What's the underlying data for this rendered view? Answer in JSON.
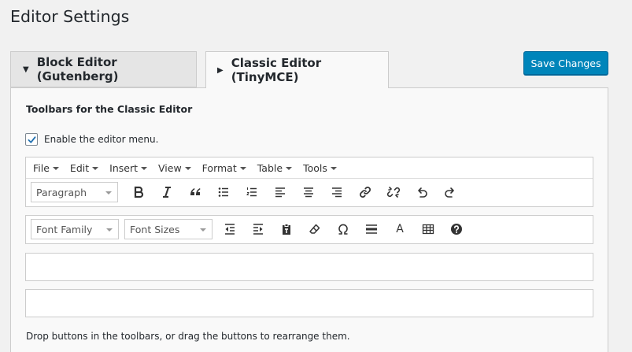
{
  "page": {
    "title": "Editor Settings"
  },
  "tabs": [
    {
      "label": "Block Editor (Gutenberg)",
      "arrow": "▼",
      "active": false
    },
    {
      "label": "Classic Editor (TinyMCE)",
      "arrow": "▶",
      "active": true
    }
  ],
  "save_button": {
    "label": "Save Changes"
  },
  "section": {
    "title": "Toolbars for the Classic Editor"
  },
  "enable_menu": {
    "label": "Enable the editor menu.",
    "checked": true
  },
  "menubar": {
    "items": [
      {
        "label": "File"
      },
      {
        "label": "Edit"
      },
      {
        "label": "Insert"
      },
      {
        "label": "View"
      },
      {
        "label": "Format"
      },
      {
        "label": "Table"
      },
      {
        "label": "Tools"
      }
    ]
  },
  "toolbar1": {
    "paragraph_select": "Paragraph",
    "icons": [
      "bold-icon",
      "italic-icon",
      "blockquote-icon",
      "bullet-list-icon",
      "numbered-list-icon",
      "align-left-icon",
      "align-center-icon",
      "align-right-icon",
      "link-icon",
      "unlink-icon",
      "undo-icon",
      "redo-icon"
    ]
  },
  "toolbar2": {
    "font_family_select": "Font Family",
    "font_sizes_select": "Font Sizes",
    "icons": [
      "outdent-icon",
      "indent-icon",
      "paste-text-icon",
      "clear-formatting-icon",
      "special-character-icon",
      "horizontal-line-icon",
      "text-color-icon",
      "table-icon",
      "help-icon"
    ],
    "text_color_glyph": "A"
  },
  "hint": {
    "text": "Drop buttons in the toolbars, or drag the buttons to rearrange them."
  },
  "colors": {
    "accent": "#0085ba",
    "check": "#2271b1"
  }
}
